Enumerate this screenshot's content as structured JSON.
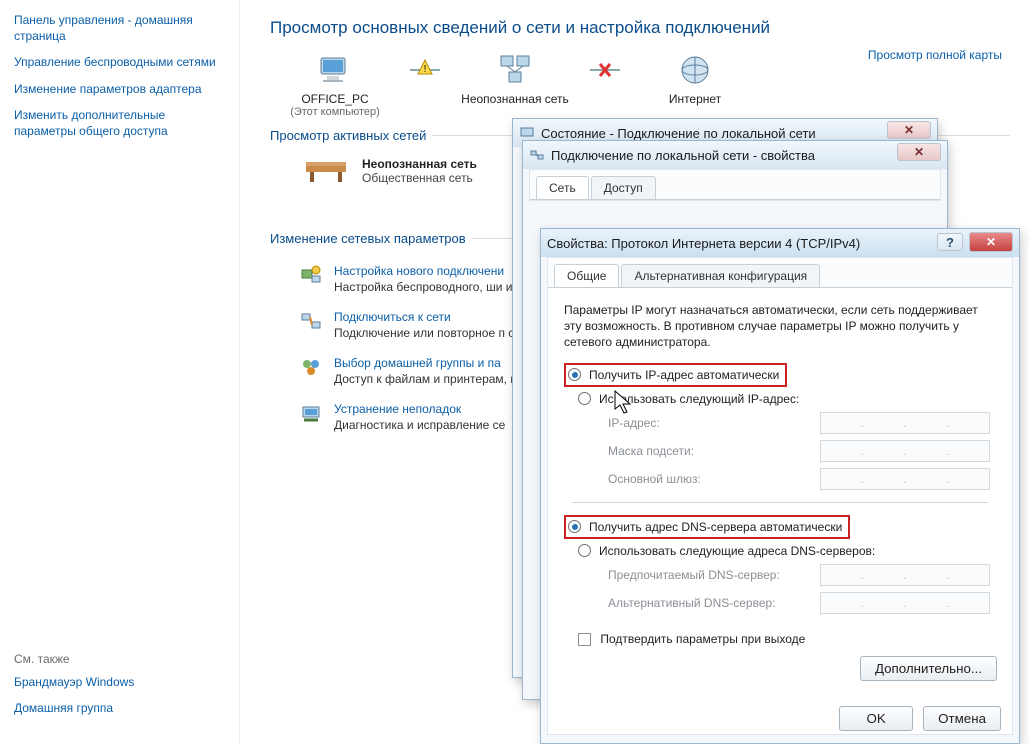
{
  "sidebar": {
    "home": "Панель управления - домашняя страница",
    "links": [
      "Управление беспроводными сетями",
      "Изменение параметров адаптера",
      "Изменить дополнительные параметры общего доступа"
    ],
    "see_also": "См. также",
    "firewall": "Брандмауэр Windows",
    "homegroup": "Домашняя группа"
  },
  "main": {
    "heading": "Просмотр основных сведений о сети и настройка подключений",
    "full_map": "Просмотр полной карты",
    "nodes": {
      "pc": "OFFICE_PC",
      "pc_sub": "(Этот компьютер)",
      "unknown": "Неопознанная сеть",
      "internet": "Интернет"
    },
    "active_title": "Просмотр активных сетей",
    "active": {
      "name": "Неопознанная сеть",
      "type": "Общественная сеть"
    },
    "params_title": "Изменение сетевых параметров",
    "tasks": [
      {
        "title": "Настройка нового подключени",
        "desc": "Настройка беспроводного, ши или же настройка маршрутиза"
      },
      {
        "title": "Подключиться к сети",
        "desc": "Подключение или повторное п сетевому соединению или подк"
      },
      {
        "title": "Выбор домашней группы и па",
        "desc": "Доступ к файлам и принтерам, изменение параметров общег"
      },
      {
        "title": "Устранение неполадок",
        "desc": "Диагностика и исправление се"
      }
    ]
  },
  "lanstatus": {
    "title": "Состояние - Подключение по локальной сети"
  },
  "lanprops": {
    "title": "Подключение по локальной сети - свойства",
    "tabs": [
      "Сеть",
      "Доступ"
    ]
  },
  "ipv4": {
    "title": "Свойства: Протокол Интернета версии 4 (TCP/IPv4)",
    "tabs": [
      "Общие",
      "Альтернативная конфигурация"
    ],
    "info": "Параметры IP могут назначаться автоматически, если сеть поддерживает эту возможность. В противном случае параметры IP можно получить у сетевого администратора.",
    "radio_ip_auto": "Получить IP-адрес автоматически",
    "radio_ip_manual": "Использовать следующий IP-адрес:",
    "ip_label": "IP-адрес:",
    "mask_label": "Маска подсети:",
    "gw_label": "Основной шлюз:",
    "radio_dns_auto": "Получить адрес DNS-сервера автоматически",
    "radio_dns_manual": "Использовать следующие адреса DNS-серверов:",
    "dns1_label": "Предпочитаемый DNS-сервер:",
    "dns2_label": "Альтернативный DNS-сервер:",
    "confirm_on_exit": "Подтвердить параметры при выходе",
    "advanced": "Дополнительно...",
    "ok": "OK",
    "cancel": "Отмена"
  }
}
